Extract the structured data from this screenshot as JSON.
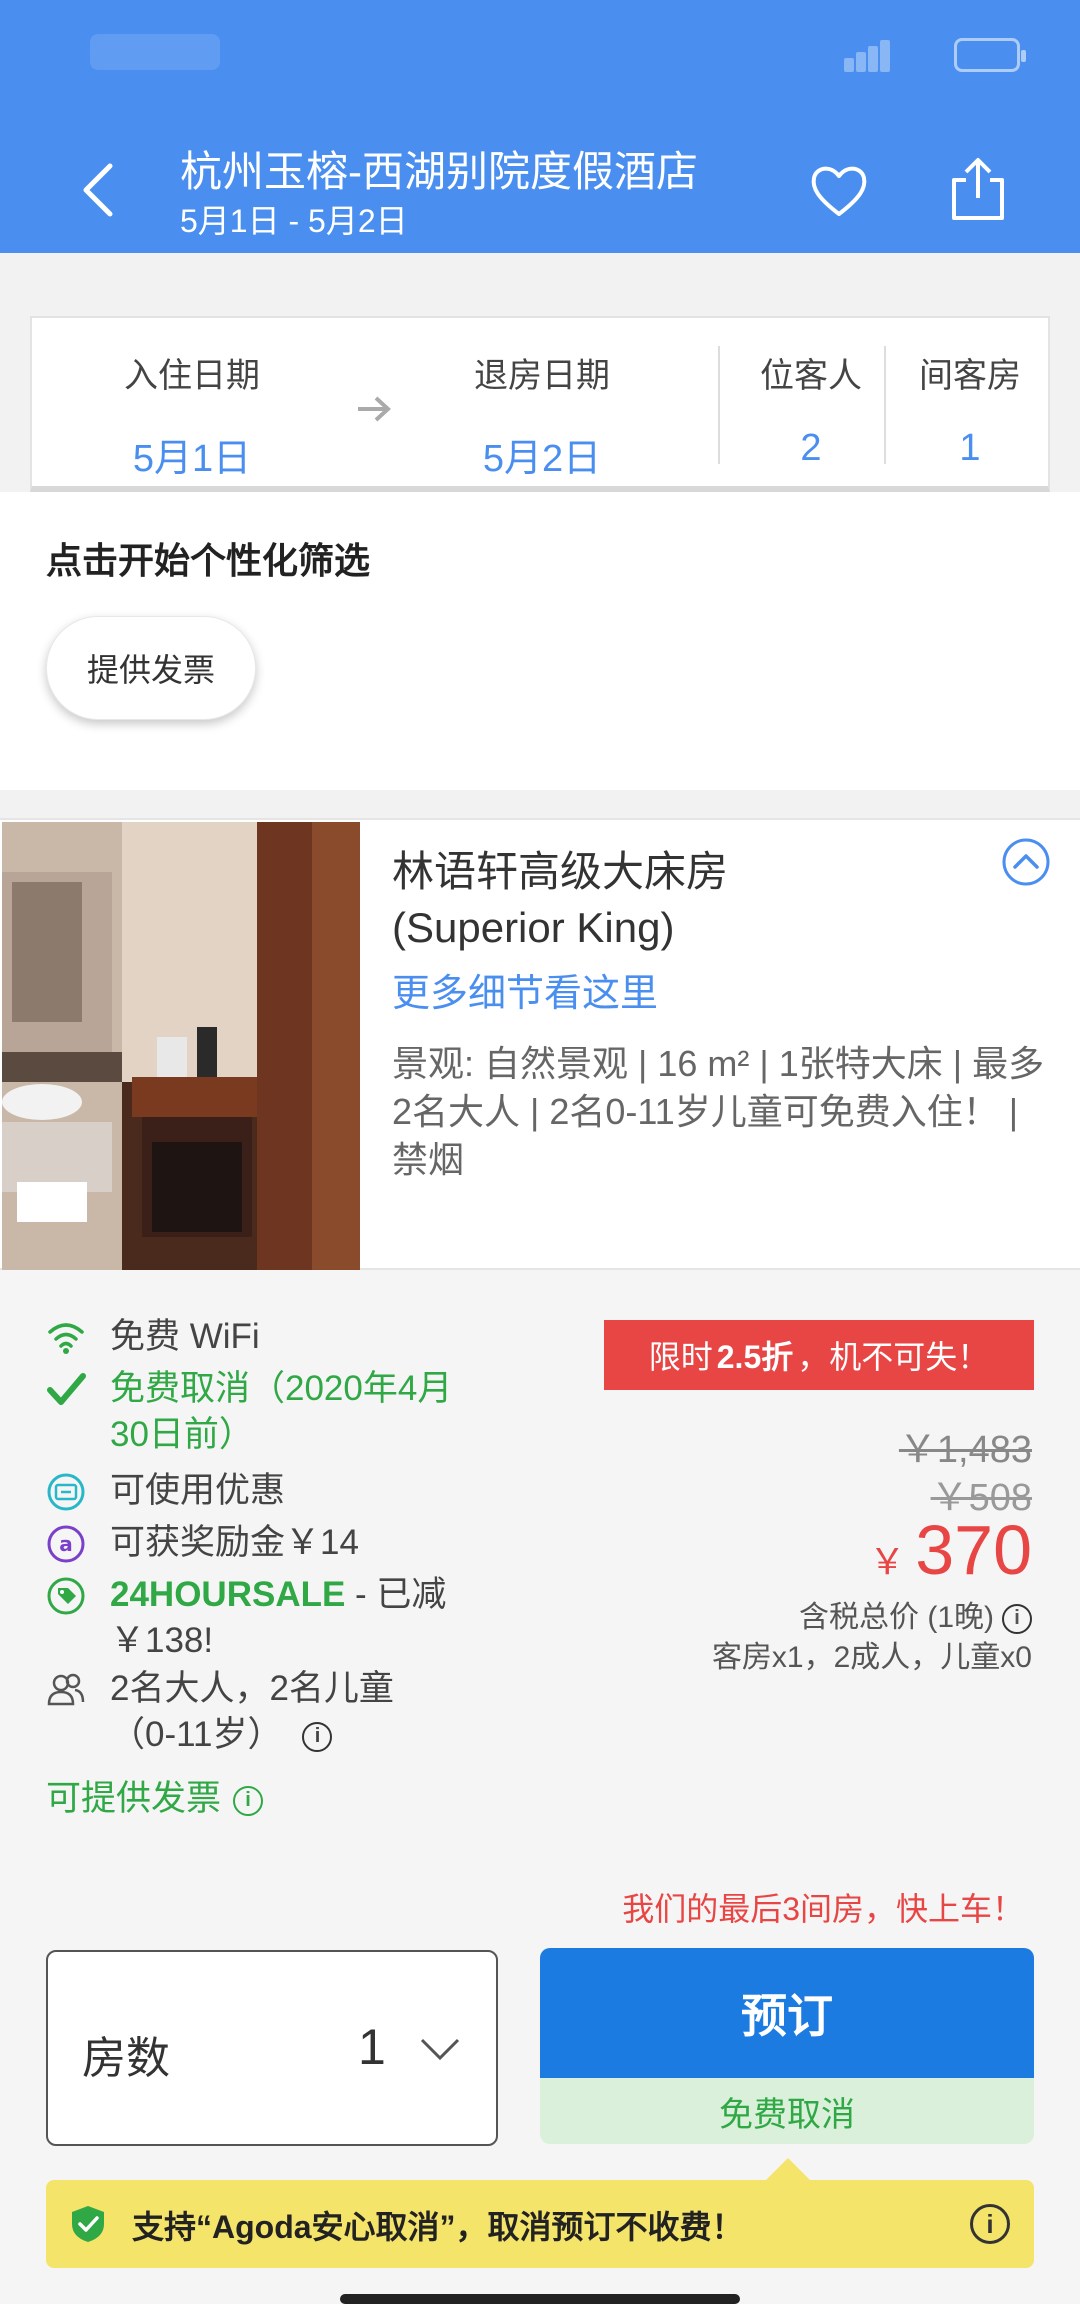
{
  "header": {
    "hotel_name": "杭州玉榕-西湖别院度假酒店",
    "stay_dates": "5月1日 - 5月2日"
  },
  "search": {
    "checkin_label": "入住日期",
    "checkin_value": "5月1日",
    "checkout_label": "退房日期",
    "checkout_value": "5月2日",
    "guests_label": "位客人",
    "guests_value": "2",
    "rooms_label": "间客房",
    "rooms_value": "1"
  },
  "filter": {
    "title": "点击开始个性化筛选",
    "chip": "提供发票"
  },
  "room": {
    "name_cn": "林语轩高级大床房",
    "name_en": "(Superior King)",
    "more_link": "更多细节看这里",
    "description": "景观: 自然景观 | 16 m² | 1张特大床 | 最多2名大人 | 2名0-11岁儿童可免费入住！ | 禁烟"
  },
  "features": {
    "wifi": "免费 WiFi",
    "cancel_line1": "免费取消（2020年4月",
    "cancel_line2": "30日前）",
    "coupon": "可使用优惠",
    "reward": "可获奖励金￥14",
    "sale_code": "24HOURSALE",
    "sale_rest": " - 已减",
    "sale_line2": "￥138!",
    "occupancy_line1": "2名大人，2名儿童",
    "occupancy_line2": "（0-11岁）",
    "invoice": "可提供发票"
  },
  "pricing": {
    "deal_prefix": "限时",
    "deal_bold": "2.5折",
    "deal_suffix": "，机不可失！",
    "original_price_1": "￥1,483",
    "original_price_2": "￥508",
    "currency": "￥",
    "current_price": "370",
    "price_note": "含税总价 (1晚)",
    "allocation": "客房x1，2成人，儿童x0",
    "scarcity": "我们的最后3间房，快上车！"
  },
  "booking": {
    "rooms_label": "房数",
    "rooms_value": "1",
    "book_button": "预订",
    "free_cancel": "免费取消"
  },
  "assurance": {
    "text": "支持“Agoda安心取消”，取消预订不收费！"
  },
  "colors": {
    "header_blue": "#4a8ff0",
    "link_blue": "#4a8ff0",
    "book_blue": "#1c7be0",
    "red": "#e84545",
    "green": "#2fa845",
    "yellow": "#f5e46a"
  }
}
